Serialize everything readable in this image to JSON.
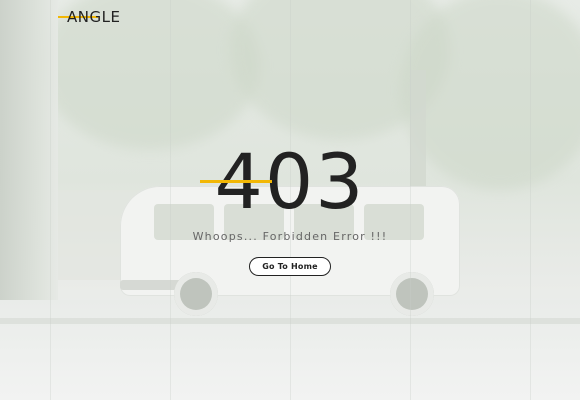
{
  "brand": {
    "name": "ANGLE",
    "accent": "#f2b705"
  },
  "error": {
    "code": "403",
    "message": "Whoops... Forbidden Error !!!",
    "button_label": "Go To Home"
  }
}
